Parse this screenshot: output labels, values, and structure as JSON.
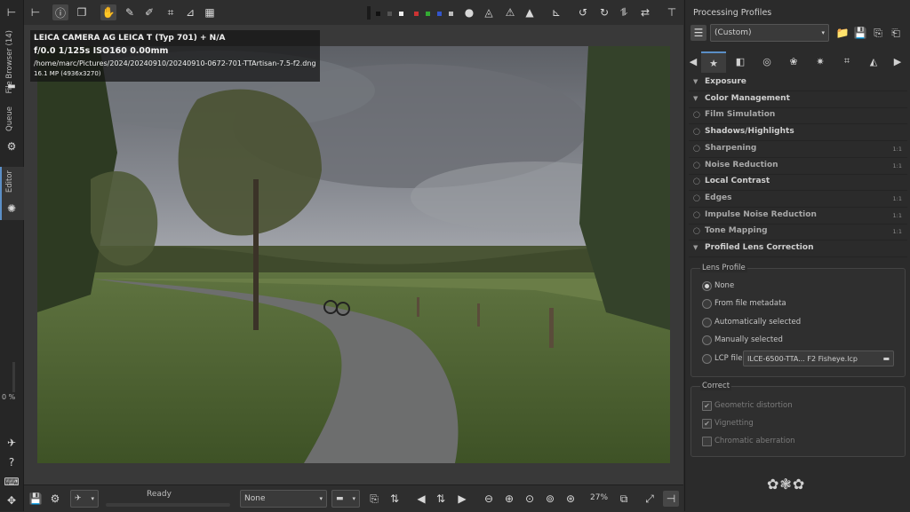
{
  "left_tabs": {
    "file_browser": "File Browser (14)",
    "queue": "Queue",
    "editor": "Editor",
    "progress": "0 %"
  },
  "info_overlay": {
    "camera": "LEICA CAMERA AG LEICA T (Typ 701) + N/A",
    "exposure": "f/0.0  1/125s  ISO160  0.00mm",
    "path": "/home/marc/Pictures/2024/20240910/20240910-0672-701-TTArtisan-7.5-f2.dng",
    "size": "16.1 MP (4936x3270)"
  },
  "bottom": {
    "status": "Ready",
    "profile_select": "None",
    "zoom": "27%"
  },
  "right_panel": {
    "title": "Processing Profiles",
    "profile_value": "(Custom)",
    "sections": [
      {
        "label": "Exposure",
        "arrow": "▼",
        "dim": false,
        "badge": ""
      },
      {
        "label": "Color Management",
        "arrow": "▼",
        "dim": false,
        "badge": ""
      },
      {
        "label": "Film Simulation",
        "arrow": "◯",
        "dim": true,
        "badge": ""
      },
      {
        "label": "Shadows/Highlights",
        "arrow": "◯",
        "dim": false,
        "badge": ""
      },
      {
        "label": "Sharpening",
        "arrow": "◯",
        "dim": true,
        "badge": "1:1"
      },
      {
        "label": "Noise Reduction",
        "arrow": "◯",
        "dim": true,
        "badge": "1:1"
      },
      {
        "label": "Local Contrast",
        "arrow": "◯",
        "dim": false,
        "badge": ""
      },
      {
        "label": "Edges",
        "arrow": "◯",
        "dim": true,
        "badge": "1:1"
      },
      {
        "label": "Impulse Noise Reduction",
        "arrow": "◯",
        "dim": true,
        "badge": "1:1"
      },
      {
        "label": "Tone Mapping",
        "arrow": "◯",
        "dim": true,
        "badge": "1:1"
      },
      {
        "label": "Profiled Lens Correction",
        "arrow": "▼",
        "dim": false,
        "badge": ""
      }
    ],
    "lens_profile": {
      "title": "Lens Profile",
      "options": [
        "None",
        "From file metadata",
        "Automatically selected",
        "Manually selected",
        "LCP file"
      ],
      "selected": "None",
      "lcp_file": "ILCE-6500-TTA...   F2 Fisheye.lcp"
    },
    "correct": {
      "title": "Correct",
      "items": [
        {
          "label": "Geometric distortion",
          "checked": true
        },
        {
          "label": "Vignetting",
          "checked": true
        },
        {
          "label": "Chromatic aberration",
          "checked": false
        }
      ]
    }
  },
  "colors": {
    "accent": "#5b8fc7",
    "panel_bg": "#2b2b2b",
    "toolbar_bg": "#2e2e2e"
  }
}
